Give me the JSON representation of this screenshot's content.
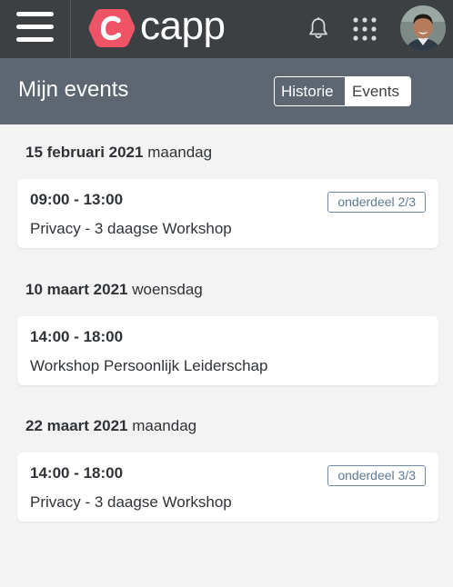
{
  "app": {
    "brand": "capp",
    "brand_color": "#ef5466",
    "topbar_color": "#3d4043",
    "subheader_color": "#5e6671"
  },
  "header": {
    "menu_icon": "hamburger-menu-icon",
    "notifications_icon": "bell-icon",
    "apps_icon": "grid-apps-icon",
    "avatar": "user-avatar"
  },
  "page": {
    "title": "Mijn events",
    "tabs": [
      {
        "label": "Historie",
        "active": true
      },
      {
        "label": "Events",
        "active": false
      }
    ]
  },
  "events": [
    {
      "date": "15 februari 2021",
      "weekday": "maandag",
      "time": "09:00 - 13:00",
      "title": "Privacy - 3 daagse Workshop",
      "badge": "onderdeel 2/3"
    },
    {
      "date": "10 maart 2021",
      "weekday": "woensdag",
      "time": "14:00 - 18:00",
      "title": "Workshop Persoonlijk Leiderschap",
      "badge": ""
    },
    {
      "date": "22 maart 2021",
      "weekday": "maandag",
      "time": "14:00 - 18:00",
      "title": "Privacy - 3 daagse Workshop",
      "badge": "onderdeel 3/3"
    }
  ]
}
